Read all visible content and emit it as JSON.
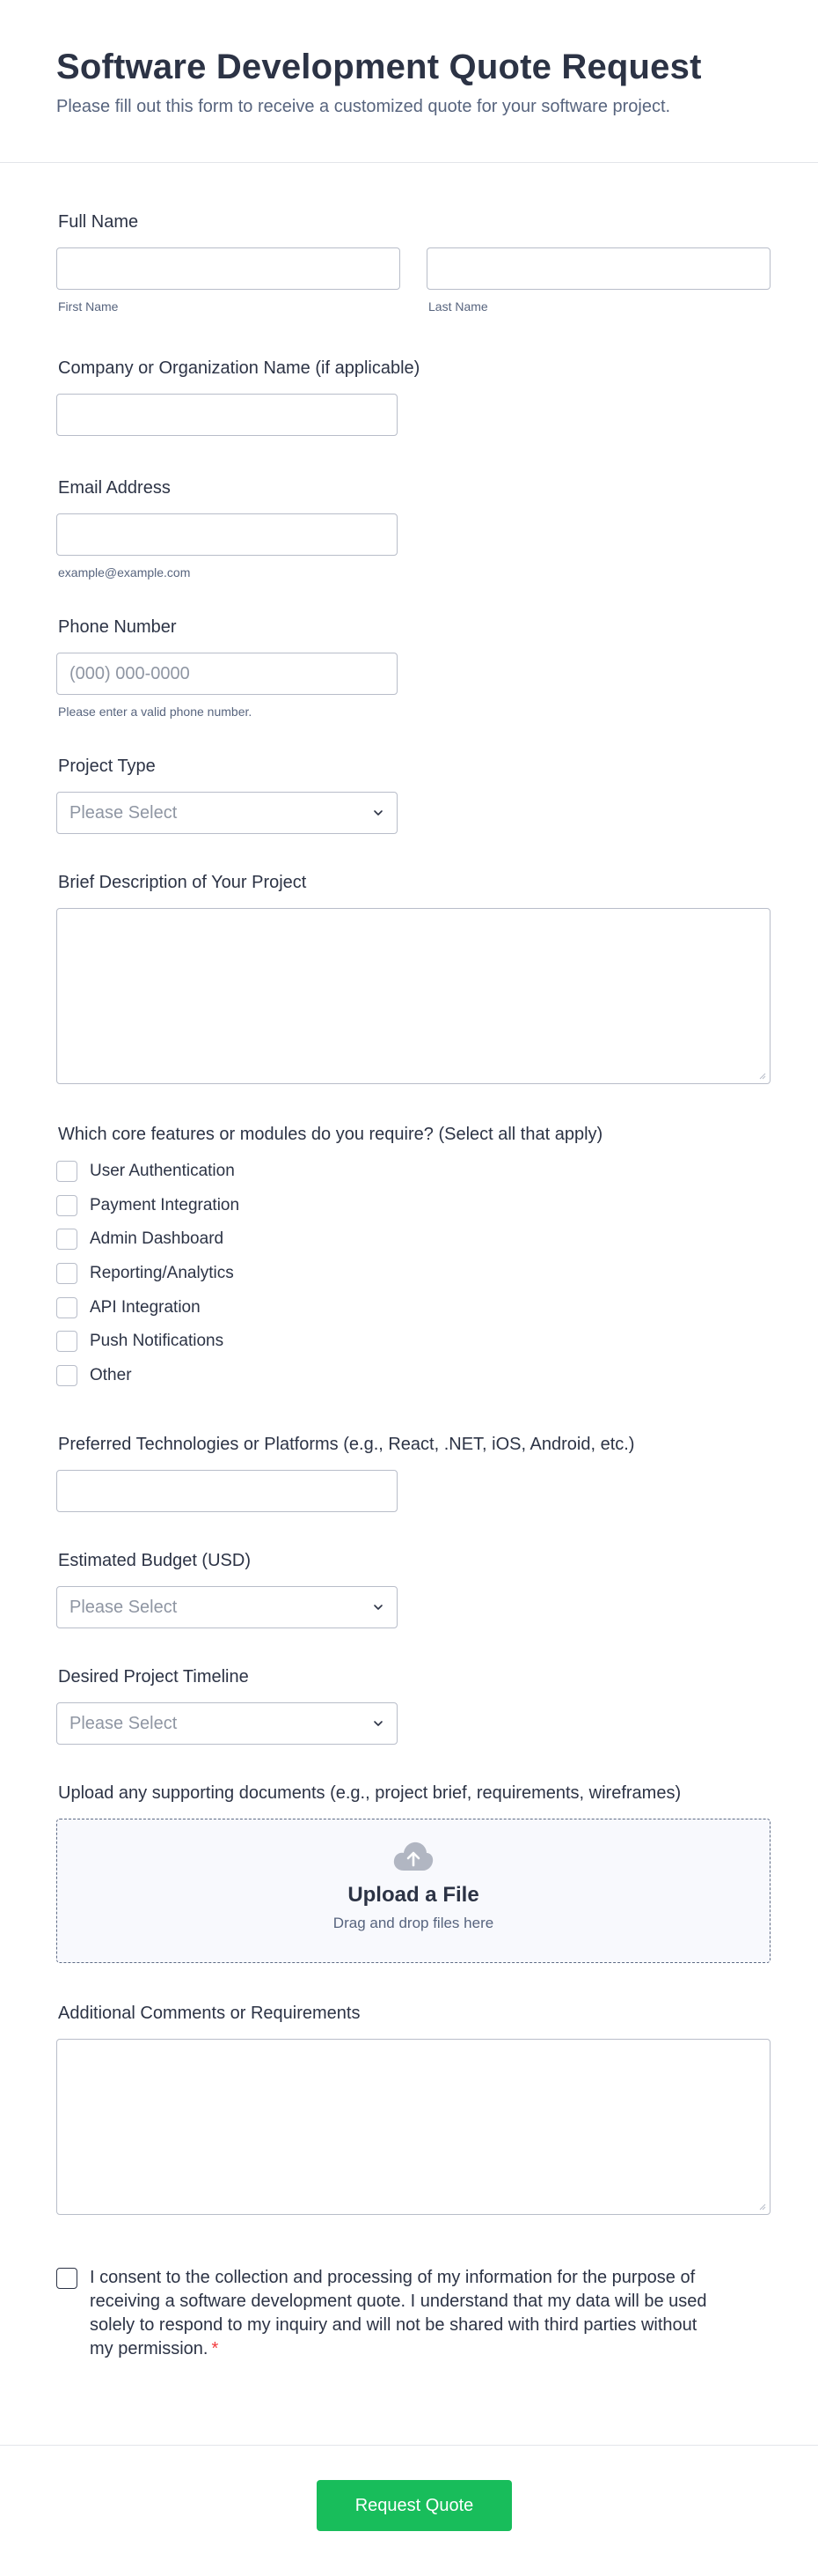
{
  "header": {
    "title": "Software Development Quote Request",
    "subtitle": "Please fill out this form to receive a customized quote for your software project."
  },
  "full_name": {
    "label": "Full Name",
    "first_sublabel": "First Name",
    "last_sublabel": "Last Name",
    "first_value": "",
    "last_value": ""
  },
  "company": {
    "label": "Company or Organization Name (if applicable)",
    "value": ""
  },
  "email": {
    "label": "Email Address",
    "sublabel": "example@example.com",
    "value": ""
  },
  "phone": {
    "label": "Phone Number",
    "placeholder": "(000) 000-0000",
    "sublabel": "Please enter a valid phone number."
  },
  "project_type": {
    "label": "Project Type",
    "selected": "Please Select"
  },
  "description": {
    "label": "Brief Description of Your Project",
    "value": ""
  },
  "features": {
    "label": "Which core features or modules do you require? (Select all that apply)",
    "options": [
      "User Authentication",
      "Payment Integration",
      "Admin Dashboard",
      "Reporting/Analytics",
      "API Integration",
      "Push Notifications",
      "Other"
    ]
  },
  "technologies": {
    "label": "Preferred Technologies or Platforms (e.g., React, .NET, iOS, Android, etc.)",
    "value": ""
  },
  "budget": {
    "label": "Estimated Budget (USD)",
    "selected": "Please Select"
  },
  "timeline": {
    "label": "Desired Project Timeline",
    "selected": "Please Select"
  },
  "upload": {
    "label": "Upload any supporting documents (e.g., project brief, requirements, wireframes)",
    "title": "Upload a File",
    "subtitle": "Drag and drop files here",
    "icon": "cloud-upload-icon"
  },
  "comments": {
    "label": "Additional Comments or Requirements",
    "value": ""
  },
  "consent": {
    "text": "I consent to the collection and processing of my information for the purpose of receiving a software development quote. I understand that my data will be used solely to respond to my inquiry and will not be shared with third parties without my permission.",
    "required_mark": "*"
  },
  "submit": {
    "label": "Request Quote"
  },
  "colors": {
    "accent": "#18bd5b",
    "text": "#2c3345",
    "muted": "#57647e",
    "border": "#b8bdc9",
    "required": "#f23a3c"
  }
}
